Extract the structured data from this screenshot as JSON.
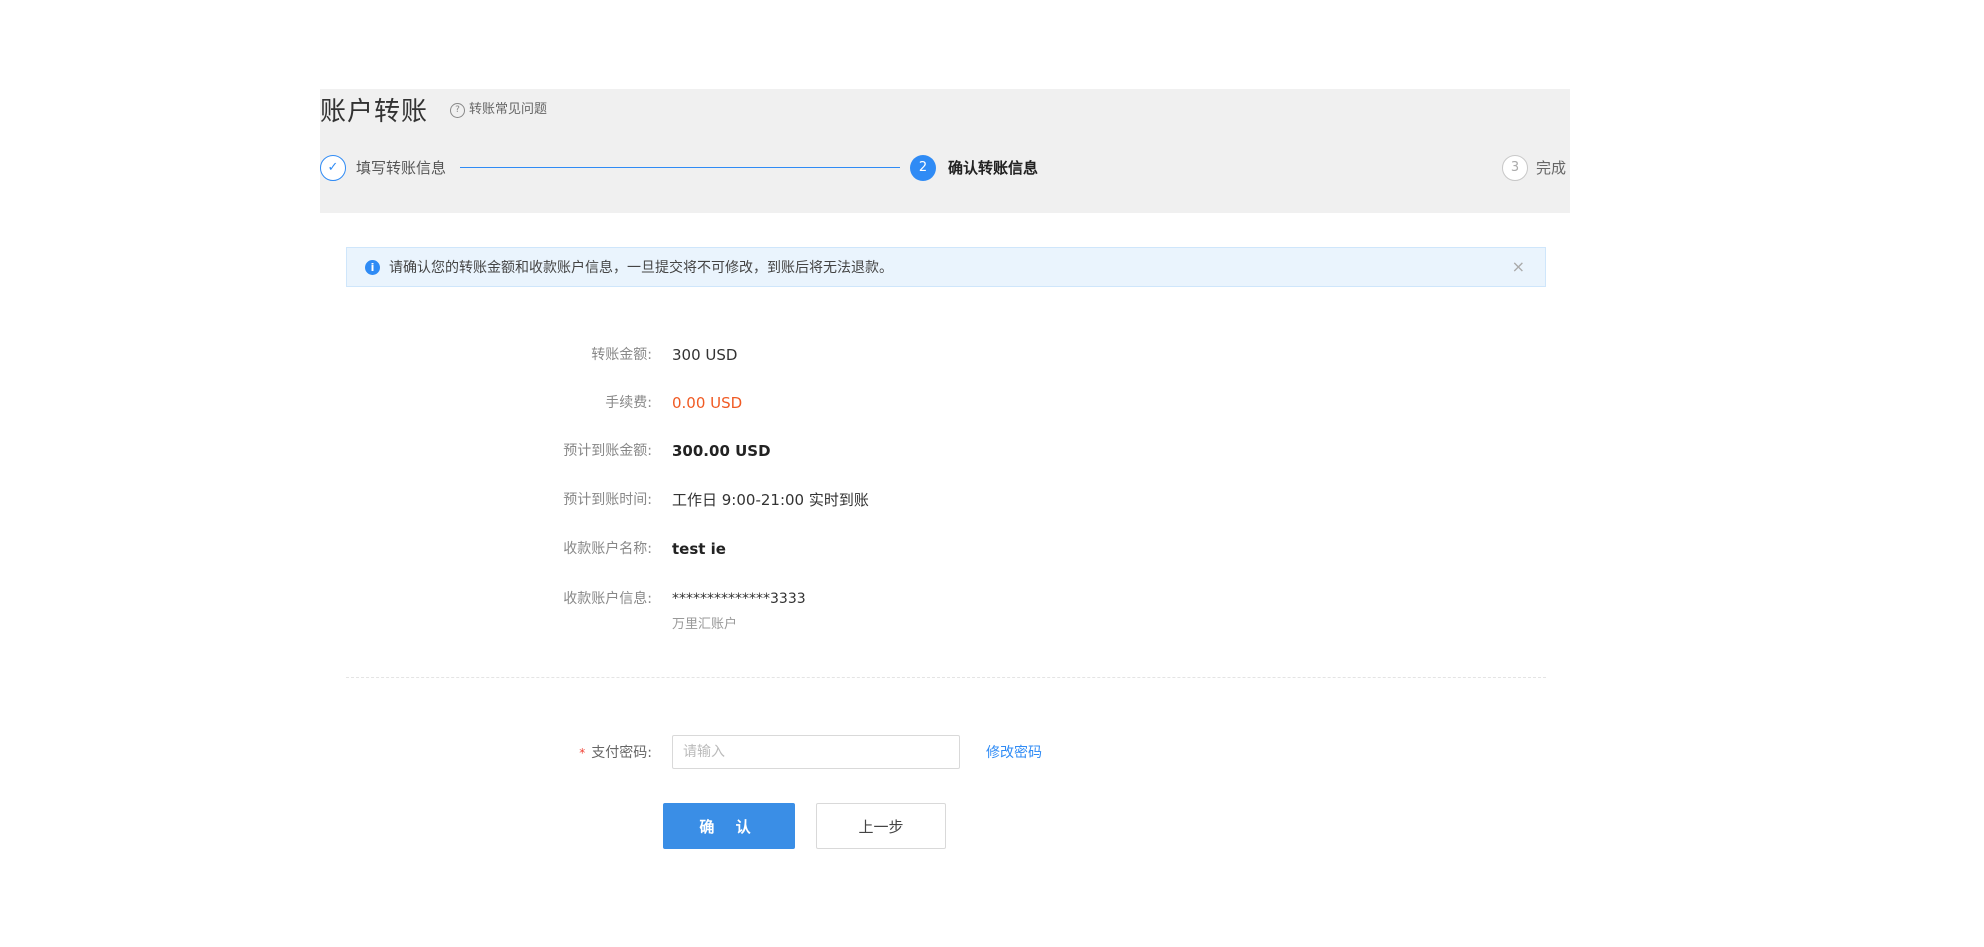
{
  "page": {
    "title": "账户转账",
    "faq_link": "转账常见问题",
    "faq_icon": "question-circle-icon"
  },
  "steps": [
    {
      "icon_text": "✓",
      "label": "填写转账信息",
      "state": "done"
    },
    {
      "icon_text": "2",
      "label": "确认转账信息",
      "state": "active"
    },
    {
      "icon_text": "3",
      "label": "完成",
      "state": "pending"
    }
  ],
  "alert": {
    "icon": "i",
    "message": "请确认您的转账金额和收款账户信息，一旦提交将不可修改，到账后将无法退款。",
    "close": "×"
  },
  "details": {
    "amount": {
      "label": "转账金额:",
      "value": "300 USD"
    },
    "fee": {
      "label": "手续费:",
      "value": "0.00 USD"
    },
    "expected_amount": {
      "label": "预计到账金额:",
      "value": "300.00 USD"
    },
    "expected_time": {
      "label": "预计到账时间:",
      "value": "工作日 9:00-21:00 实时到账"
    },
    "payee_name": {
      "label": "收款账户名称:",
      "value": "test ie"
    },
    "payee_info": {
      "label": "收款账户信息:",
      "value": "**************3333",
      "sub": "万里汇账户"
    }
  },
  "password": {
    "required_mark": "*",
    "label": "支付密码:",
    "placeholder": "请输入",
    "change_link": "修改密码"
  },
  "buttons": {
    "confirm": "确 认",
    "back": "上一步"
  },
  "colors": {
    "accent": "#2f8bf5",
    "fee": "#f05a23",
    "required": "#f04134"
  }
}
